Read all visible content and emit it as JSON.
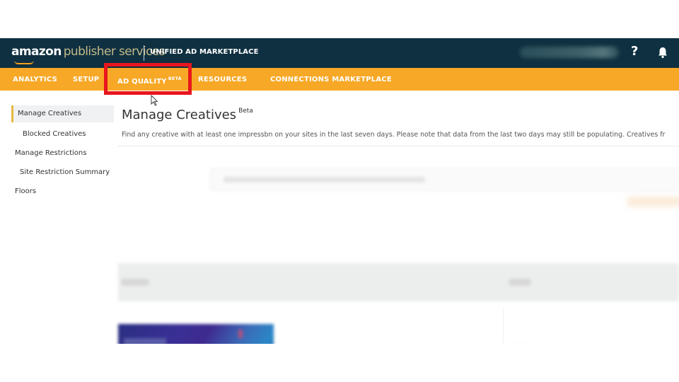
{
  "header": {
    "brand_bold": "amazon",
    "brand_light": "publisher services",
    "product": "UNIFIED AD MARKETPLACE",
    "account": "",
    "help_icon": "question-mark-icon",
    "notifications_icon": "bell-icon"
  },
  "nav": {
    "items": [
      {
        "label": "ANALYTICS"
      },
      {
        "label": "SETUP"
      },
      {
        "label": "AD QUALITY",
        "badge": "BETA",
        "highlighted": true
      },
      {
        "label": "RESOURCES"
      },
      {
        "label": "CONNECTIONS MARKETPLACE"
      }
    ],
    "highlight_color": "#e8161d"
  },
  "sidebar": {
    "items": [
      {
        "label": "Manage Creatives",
        "active": true
      },
      {
        "label": "Blocked Creatives"
      },
      {
        "label": "Manage Restrictions"
      },
      {
        "label": "Site Restriction Summary"
      },
      {
        "label": "Floors"
      }
    ]
  },
  "main": {
    "title": "Manage Creatives",
    "title_badge": "Beta",
    "description": "Find any creative with at least one impressbn on your sites in the last seven days. Please note that data from the last two days may still be populating. Creatives fr"
  },
  "colors": {
    "topbar": "#0f3040",
    "navbar": "#f7a826",
    "accent": "#f2a72b"
  }
}
